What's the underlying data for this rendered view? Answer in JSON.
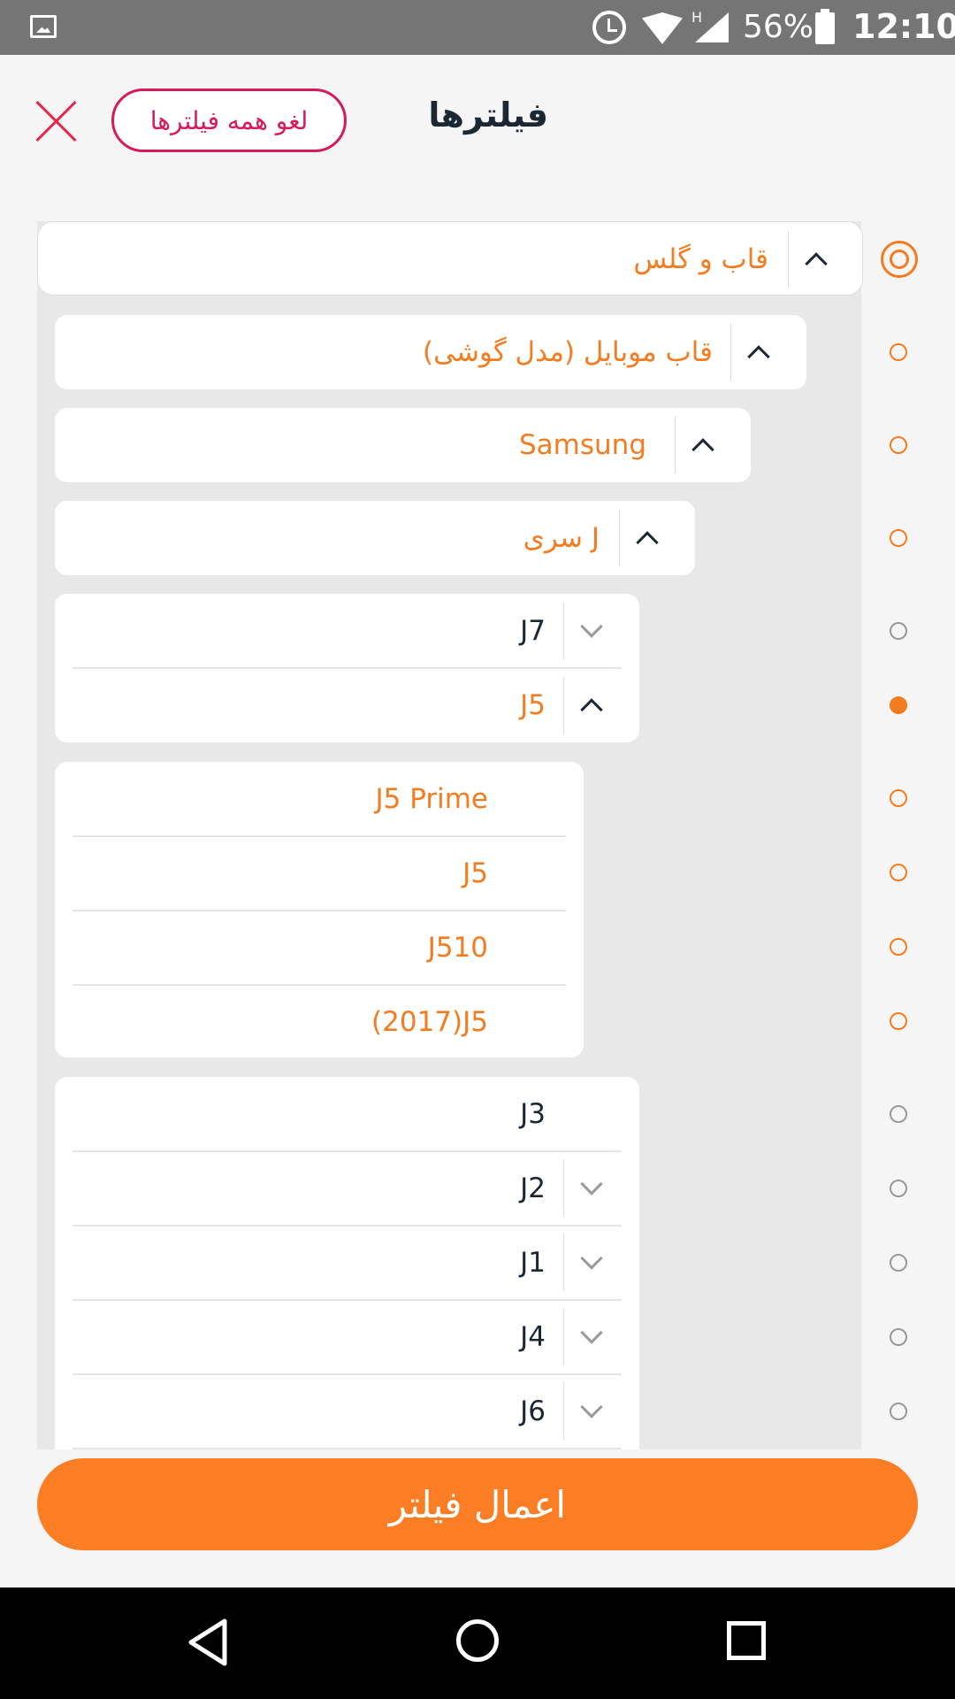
{
  "status_bar": {
    "battery": "56%",
    "time": "12:10",
    "network": "H"
  },
  "header": {
    "title": "فیلترها",
    "clear_all": "لغو همه فیلترها"
  },
  "tree": {
    "level1": "قاب و گلس",
    "level2": "قاب موبایل (مدل گوشی)",
    "level3": "Samsung",
    "level4": "سری J",
    "group_a": [
      "J7",
      "J5"
    ],
    "j5_children": [
      "J5 Prime",
      "J5",
      "J510",
      "(2017)J5"
    ],
    "group_b": [
      "J3",
      "J2",
      "J1",
      "J4",
      "J6"
    ]
  },
  "apply_button": "اعمال فیلتر",
  "colors": {
    "accent": "#f47c20",
    "danger": "#d81a5a",
    "text": "#1b2733"
  },
  "icons": [
    "close-icon",
    "chevron-up-icon",
    "chevron-down-icon",
    "back-icon",
    "home-icon",
    "recent-apps-icon"
  ]
}
